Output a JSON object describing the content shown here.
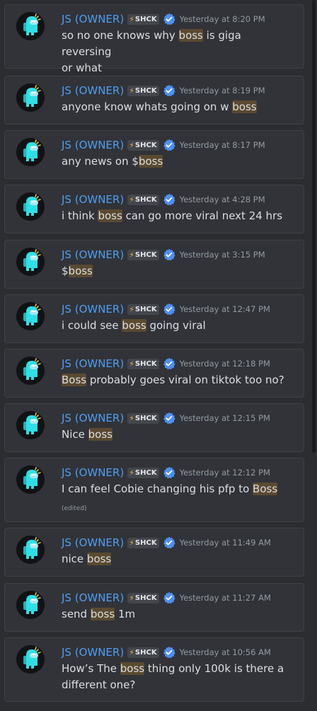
{
  "author": {
    "name": "JS (OWNER)",
    "tag": "SHCK",
    "tag_icon": "bolt-icon",
    "avatar": "crewmate-avatar",
    "verified": "verified-check-icon"
  },
  "colors": {
    "background": "#2b2d31",
    "card": "#313338",
    "name": "#4f9ef0",
    "highlight": "#5a4a30",
    "timestamp": "#949ba4",
    "verified": "#4d8ff0",
    "avatar_body": "#2ee0e6"
  },
  "messages": [
    {
      "time": "Yesterday at 8:20 PM",
      "lines": [
        [
          "so no one knows why ",
          {
            "hl": "boss"
          },
          " is giga reversing"
        ],
        [
          "or what"
        ]
      ],
      "edited": ""
    },
    {
      "time": "Yesterday at 8:19 PM",
      "lines": [
        [
          "anyone know whats going on w ",
          {
            "hl": "boss"
          }
        ]
      ],
      "edited": ""
    },
    {
      "time": "Yesterday at 8:17 PM",
      "lines": [
        [
          "any news on $",
          {
            "hl": "boss"
          }
        ]
      ],
      "edited": ""
    },
    {
      "time": "Yesterday at 4:28 PM",
      "lines": [
        [
          "i think ",
          {
            "hl": "boss"
          },
          " can go more viral next 24 hrs"
        ]
      ],
      "edited": ""
    },
    {
      "time": "Yesterday at 3:15 PM",
      "lines": [
        [
          "$",
          {
            "hl": "boss"
          }
        ]
      ],
      "edited": ""
    },
    {
      "time": "Yesterday at 12:47 PM",
      "lines": [
        [
          "i could see ",
          {
            "hl": "boss"
          },
          " going viral"
        ]
      ],
      "edited": ""
    },
    {
      "time": "Yesterday at 12:18 PM",
      "lines": [
        [
          {
            "hl": "Boss"
          },
          " probably goes viral on tiktok too no?"
        ]
      ],
      "edited": ""
    },
    {
      "time": "Yesterday at 12:15 PM",
      "lines": [
        [
          "Nice ",
          {
            "hl": "boss"
          }
        ]
      ],
      "edited": ""
    },
    {
      "time": "Yesterday at 12:12 PM",
      "lines": [
        [
          "I can feel Cobie changing his pfp to ",
          {
            "hl": "Boss"
          }
        ]
      ],
      "edited": "(edited)"
    },
    {
      "time": "Yesterday at 11:49 AM",
      "lines": [
        [
          "nice ",
          {
            "hl": "boss"
          }
        ]
      ],
      "edited": ""
    },
    {
      "time": "Yesterday at 11:27 AM",
      "lines": [
        [
          "send ",
          {
            "hl": "boss"
          },
          " 1m"
        ]
      ],
      "edited": ""
    },
    {
      "time": "Yesterday at 10:56 AM",
      "lines": [
        [
          "How’s The ",
          {
            "hl": "boss"
          },
          " thing only 100k is there a"
        ],
        [
          "different one?"
        ]
      ],
      "edited": ""
    }
  ]
}
